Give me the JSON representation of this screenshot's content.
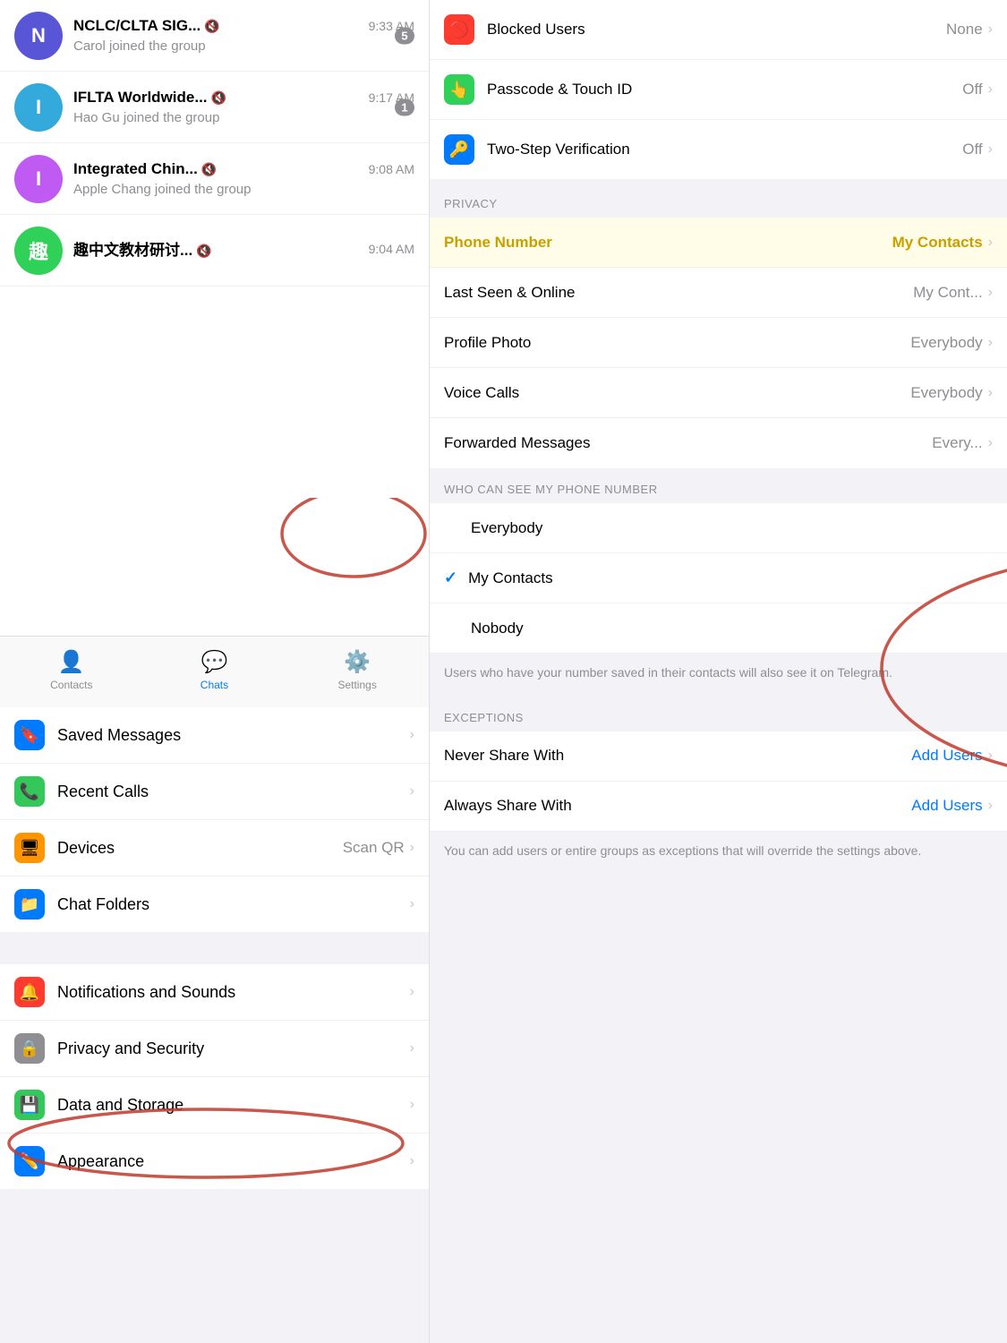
{
  "left": {
    "chats": [
      {
        "id": "nclc",
        "initials": "N",
        "avatarColor": "#5856d6",
        "name": "NCLC/CLTA SIG...",
        "muted": true,
        "time": "9:33 AM",
        "preview": "Carol joined the group",
        "badge": "5"
      },
      {
        "id": "iflta",
        "initials": "I",
        "avatarColor": "#34aadc",
        "name": "IFLTA Worldwide...",
        "muted": true,
        "time": "9:17 AM",
        "preview": "Hao Gu joined the group",
        "badge": "1"
      },
      {
        "id": "integrated",
        "initials": "I",
        "avatarColor": "#bf5af2",
        "name": "Integrated Chin...",
        "muted": true,
        "time": "9:08 AM",
        "preview": "Apple Chang joined the group",
        "badge": null
      },
      {
        "id": "zhongwen",
        "initials": "趣",
        "avatarColor": "#30d158",
        "name": "趣中文教材研讨...",
        "muted": true,
        "time": "9:04 AM",
        "preview": "",
        "badge": null
      }
    ],
    "nav": {
      "items": [
        {
          "id": "contacts",
          "label": "Contacts",
          "active": false,
          "icon": "👤"
        },
        {
          "id": "chats",
          "label": "Chats",
          "active": true,
          "icon": "💬"
        },
        {
          "id": "settings",
          "label": "Settings",
          "active": false,
          "icon": "⚙️"
        }
      ]
    },
    "settings": {
      "items": [
        {
          "id": "saved-messages",
          "icon": "🔖",
          "iconBg": "#007aff",
          "label": "Saved Messages",
          "value": "",
          "chevron": true
        },
        {
          "id": "recent-calls",
          "icon": "📞",
          "iconBg": "#34c759",
          "label": "Recent Calls",
          "value": "",
          "chevron": true
        },
        {
          "id": "devices",
          "icon": "🖥",
          "iconBg": "#ff9500",
          "label": "Devices",
          "value": "Scan QR",
          "chevron": true
        },
        {
          "id": "chat-folders",
          "icon": "📁",
          "iconBg": "#007aff",
          "label": "Chat Folders",
          "value": "",
          "chevron": true
        },
        {
          "id": "notifications",
          "icon": "🔔",
          "iconBg": "#ff3b30",
          "label": "Notifications and Sounds",
          "value": "",
          "chevron": true
        },
        {
          "id": "privacy-security",
          "icon": "🔒",
          "iconBg": "#8e8e93",
          "label": "Privacy and Security",
          "value": "",
          "chevron": true
        },
        {
          "id": "data-storage",
          "icon": "💾",
          "iconBg": "#34c759",
          "label": "Data and Storage",
          "value": "",
          "chevron": true
        },
        {
          "id": "appearance",
          "icon": "✏️",
          "iconBg": "#007aff",
          "label": "Appearance",
          "value": "",
          "chevron": true
        }
      ]
    }
  },
  "right": {
    "security_items": [
      {
        "id": "blocked-users",
        "iconBg": "#ff3b30",
        "icon": "🚫",
        "label": "Blocked Users",
        "value": "None"
      },
      {
        "id": "passcode-touchid",
        "iconBg": "#30d158",
        "icon": "👆",
        "label": "Passcode & Touch ID",
        "value": "Off"
      },
      {
        "id": "two-step",
        "iconBg": "#007aff",
        "icon": "🔑",
        "label": "Two-Step Verification",
        "value": "Off"
      }
    ],
    "privacy_header": "PRIVACY",
    "privacy_items": [
      {
        "id": "phone-number",
        "label": "Phone Number",
        "value": "My Contacts",
        "highlighted": true
      },
      {
        "id": "last-seen",
        "label": "Last Seen & Online",
        "value": "My Cont..."
      },
      {
        "id": "profile-photo",
        "label": "Profile Photo",
        "value": "Everybody"
      },
      {
        "id": "voice-calls",
        "label": "Voice Calls",
        "value": "Everybody"
      },
      {
        "id": "forwarded-messages",
        "label": "Forwarded Messages",
        "value": "Every..."
      }
    ],
    "who_can_see_header": "WHO CAN SEE MY PHONE NUMBER",
    "who_options": [
      {
        "id": "everybody",
        "label": "Everybody",
        "selected": false
      },
      {
        "id": "my-contacts",
        "label": "My Contacts",
        "selected": true
      },
      {
        "id": "nobody",
        "label": "Nobody",
        "selected": false
      }
    ],
    "who_description": "Users who have your number saved in their contacts will also see it on Telegram.",
    "exceptions_header": "EXCEPTIONS",
    "exceptions_items": [
      {
        "id": "never-share",
        "label": "Never Share With",
        "value": "Add Users"
      },
      {
        "id": "always-share",
        "label": "Always Share With",
        "value": "Add Users"
      }
    ],
    "exceptions_description": "You can add users or entire groups as exceptions that will override the settings above."
  }
}
